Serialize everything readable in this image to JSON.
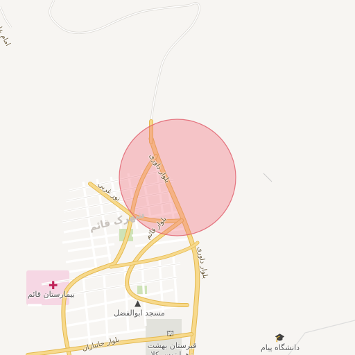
{
  "map": {
    "labels": {
      "imam_ali": "امام علی",
      "davari": "بلوار داوری",
      "noor_gharbi": "نور غربی",
      "qaem_blvd": "بلوار قائم",
      "district": "شهرک قائم",
      "hospital": "بیمارستان قائم",
      "mosque": "مسجد ابوالفضل",
      "janbazan": "بلوار جانبازان",
      "cemetery": "قبرستان بهشت زهرا توس کلا",
      "university": "دانشگاه پیام"
    },
    "icons": {
      "hospital": "hospital-cross-icon",
      "mosque": "mosque-icon",
      "cemetery": "cemetery-icon",
      "university": "graduation-cap-icon"
    },
    "colors": {
      "background": "#f7f5f2",
      "major_road": "#f7d98c",
      "minor_road": "#ffffff",
      "highlight_circle": "#f06a78",
      "hospital_area": "#f6d7e4",
      "park": "#cfe3b8",
      "cemetery": "#e2e2dc"
    }
  }
}
